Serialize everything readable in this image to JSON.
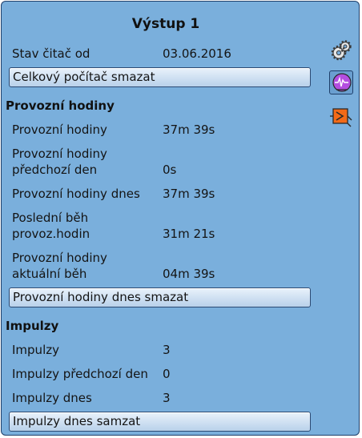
{
  "title": "Výstup 1",
  "counter": {
    "label": "Stav čitač od",
    "value": "03.06.2016",
    "reset_button": "Celkový počítač smazat"
  },
  "operating_hours": {
    "heading": "Provozní hodiny",
    "rows": [
      {
        "label_1": "Provozní hodiny",
        "label_2": "",
        "value": "37m 39s"
      },
      {
        "label_1": "Provozní hodiny",
        "label_2": "předchozí den",
        "value": "0s"
      },
      {
        "label_1": "Provozní hodiny dnes",
        "label_2": "",
        "value": "37m 39s"
      },
      {
        "label_1": "Poslední běh",
        "label_2": "provoz.hodin",
        "value": "31m 21s"
      },
      {
        "label_1": "Provozní hodiny",
        "label_2": "aktuální běh",
        "value": "04m 39s"
      }
    ],
    "reset_button": "Provozní hodiny dnes smazat"
  },
  "impulses": {
    "heading": "Impulzy",
    "rows": [
      {
        "label": "Impulzy",
        "value": "3"
      },
      {
        "label": "Impulzy předchozí den",
        "value": "0"
      },
      {
        "label": "Impulzy dnes",
        "value": "3"
      }
    ],
    "reset_button": "Impulzy dnes samzat"
  },
  "icons": {
    "settings": "gear-icon",
    "recorder": "chart-recorder-icon",
    "output": "output-switch-icon"
  },
  "colors": {
    "panel_bg": "#7aafdc",
    "border": "#1f3f6a",
    "accent_purple": "#b44ee0",
    "accent_orange": "#f36a17"
  }
}
